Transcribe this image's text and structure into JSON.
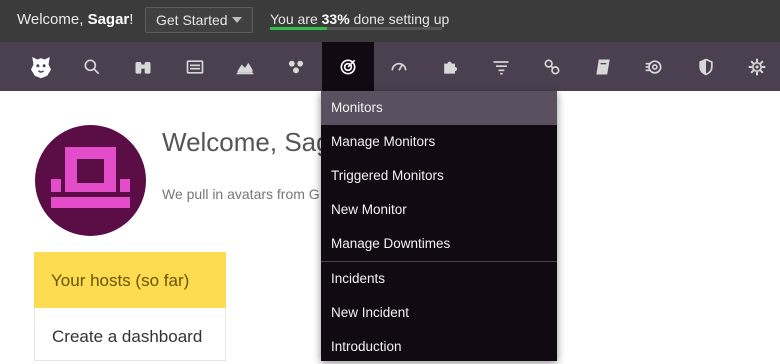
{
  "topbar": {
    "welcome_prefix": "Welcome, ",
    "user_name": "Sagar",
    "welcome_suffix": "!",
    "get_started_label": "Get Started",
    "progress_prefix": "You are ",
    "progress_percent_text": "33%",
    "progress_suffix": " done setting up",
    "progress_fraction": 0.33,
    "progress_color": "#2fbf4a"
  },
  "nav": {
    "background": "#4a4050",
    "active_background": "#120a12",
    "items": [
      {
        "icon": "datadog-logo-icon"
      },
      {
        "icon": "search-icon"
      },
      {
        "icon": "binoculars-icon"
      },
      {
        "icon": "dashboard-icon"
      },
      {
        "icon": "metrics-chart-icon"
      },
      {
        "icon": "hexagons-icon"
      },
      {
        "icon": "monitors-icon",
        "active": true
      },
      {
        "icon": "gauge-icon"
      },
      {
        "icon": "puzzle-icon"
      },
      {
        "icon": "logs-icon"
      },
      {
        "icon": "link-icon"
      },
      {
        "icon": "notebook-icon"
      },
      {
        "icon": "synthetics-icon"
      },
      {
        "icon": "security-shield-icon"
      },
      {
        "icon": "gear-icon"
      }
    ]
  },
  "main": {
    "title": "Welcome, Saga",
    "subtitle": "We pull in avatars from G",
    "hosts_card_label": "Your hosts (so far)",
    "dashboard_card_label": "Create a dashboard",
    "hosts_card_color": "#fddc51",
    "avatar_color": "#5b0d45",
    "avatar_glyph_color": "#e34dc9"
  },
  "dropdown": {
    "items": [
      {
        "label": "Monitors",
        "highlighted": true
      },
      {
        "label": "Manage Monitors"
      },
      {
        "label": "Triggered Monitors"
      },
      {
        "label": "New Monitor"
      },
      {
        "label": "Manage Downtimes"
      },
      {
        "label": "Incidents"
      },
      {
        "label": "New Incident"
      },
      {
        "label": "Introduction"
      }
    ]
  }
}
